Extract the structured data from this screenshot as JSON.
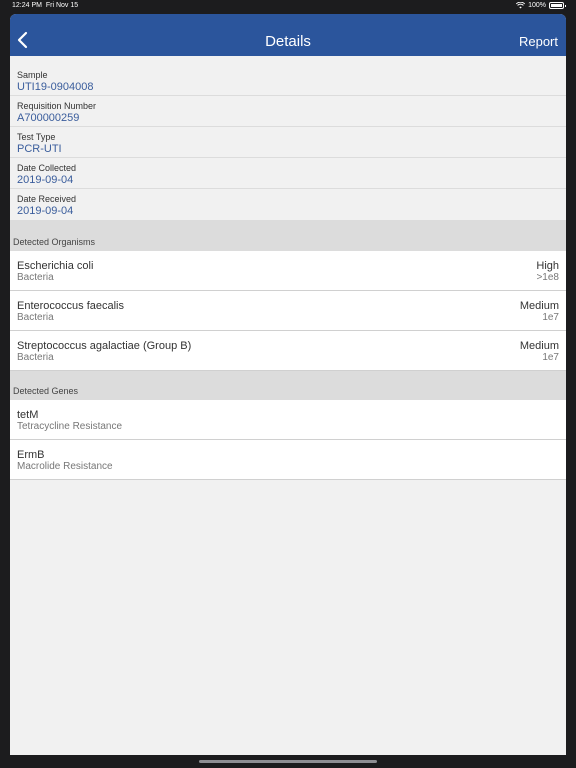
{
  "status_bar": {
    "time": "12:24 PM",
    "date": "Fri Nov 15",
    "battery": "100%"
  },
  "nav": {
    "title": "Details",
    "back_icon": "chevron-left-icon",
    "report_label": "Report"
  },
  "info": [
    {
      "label": "Sample",
      "value": "UTI19-0904008"
    },
    {
      "label": "Requisition Number",
      "value": "A700000259"
    },
    {
      "label": "Test Type",
      "value": "PCR-UTI"
    },
    {
      "label": "Date Collected",
      "value": "2019-09-04"
    },
    {
      "label": "Date Received",
      "value": "2019-09-04"
    }
  ],
  "organisms": {
    "header": "Detected Organisms",
    "items": [
      {
        "name": "Escherichia coli",
        "type": "Bacteria",
        "level": "High",
        "count": ">1e8"
      },
      {
        "name": "Enterococcus faecalis",
        "type": "Bacteria",
        "level": "Medium",
        "count": "1e7"
      },
      {
        "name": "Streptococcus agalactiae (Group B)",
        "type": "Bacteria",
        "level": "Medium",
        "count": "1e7"
      }
    ]
  },
  "genes": {
    "header": "Detected Genes",
    "items": [
      {
        "name": "tetM",
        "desc": "Tetracycline Resistance"
      },
      {
        "name": "ErmB",
        "desc": "Macrolide Resistance"
      }
    ]
  },
  "colors": {
    "nav_bar": "#2b559c",
    "value_text": "#3a5d9c",
    "section_header": "#dcdcdc",
    "background": "#f1f1f1"
  }
}
